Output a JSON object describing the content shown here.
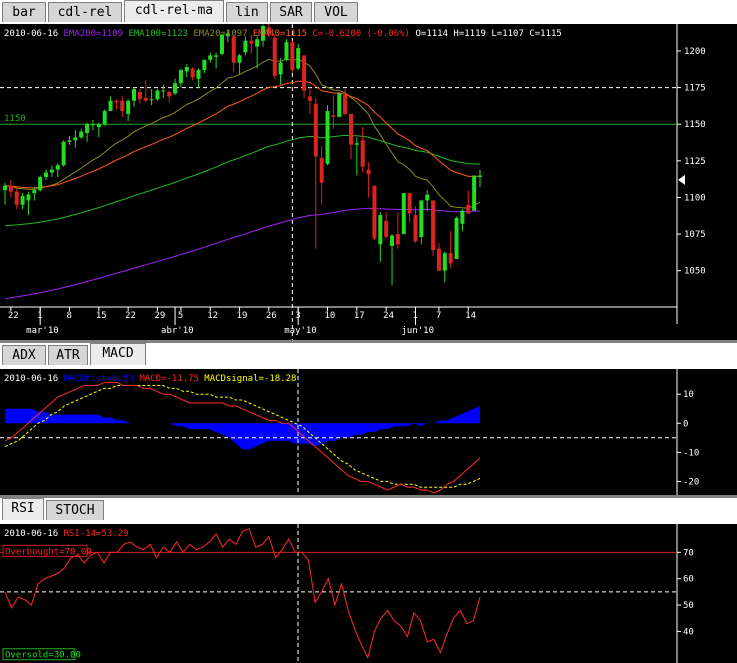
{
  "main_tabs": [
    {
      "label": "bar",
      "selected": false
    },
    {
      "label": "cdl-rel",
      "selected": false
    },
    {
      "label": "cdl-rel-ma",
      "selected": true
    },
    {
      "label": "lin",
      "selected": false
    },
    {
      "label": "SAR",
      "selected": false
    },
    {
      "label": "VOL",
      "selected": false
    }
  ],
  "macd_tabs": [
    {
      "label": "ADX",
      "selected": false
    },
    {
      "label": "ATR",
      "selected": false
    },
    {
      "label": "MACD",
      "selected": true
    }
  ],
  "rsi_tabs": [
    {
      "label": "RSI",
      "selected": true
    },
    {
      "label": "STOCH",
      "selected": false
    }
  ],
  "colors": {
    "up": "#22dd22",
    "down": "#dd2222",
    "ema200": "#a020f0",
    "ema100": "#22bb22",
    "ema20": "#8a8a20",
    "ema40": "#ff5a1a",
    "macd_hist": "#0000ff",
    "signal": "#ffff00",
    "rsi": "#ff2a2a"
  },
  "chart_data": [
    {
      "type": "candlestick",
      "legend": [
        {
          "text": "2010-06-16",
          "color": "#ffffff"
        },
        {
          "text": "EMA200=1109",
          "color": "#a020f0"
        },
        {
          "text": "EMA100=1123",
          "color": "#22bb22"
        },
        {
          "text": "EMA20=1097",
          "color": "#8a8a20"
        },
        {
          "text": "EMA40=1115",
          "color": "#ff5a1a"
        },
        {
          "text": "C=-0.6200 (-0.06%)",
          "color": "#ff2222"
        },
        {
          "text": "O=1114 H=1119 L=1107 C=1115",
          "color": "#ffffff"
        }
      ],
      "ylim": [
        1030,
        1215
      ],
      "y_ticks": [
        1050,
        1075,
        1100,
        1125,
        1150,
        1175,
        1200
      ],
      "hline_label": "1150",
      "hline_value": 1150,
      "crosshair_y": 1175,
      "crosshair_date": "2010-04-30",
      "last_price_marker": 1112,
      "x_ticks": [
        {
          "label": "22",
          "date": "2010-02-22"
        },
        {
          "label": "1",
          "date": "2010-03-01"
        },
        {
          "label": "8",
          "date": "2010-03-08"
        },
        {
          "label": "15",
          "date": "2010-03-15"
        },
        {
          "label": "22",
          "date": "2010-03-22"
        },
        {
          "label": "29",
          "date": "2010-03-29"
        },
        {
          "label": "5",
          "date": "2010-04-05"
        },
        {
          "label": "12",
          "date": "2010-04-12"
        },
        {
          "label": "19",
          "date": "2010-04-19"
        },
        {
          "label": "26",
          "date": "2010-04-26"
        },
        {
          "label": "3",
          "date": "2010-05-03"
        },
        {
          "label": "10",
          "date": "2010-05-10"
        },
        {
          "label": "17",
          "date": "2010-05-17"
        },
        {
          "label": "24",
          "date": "2010-05-24"
        },
        {
          "label": "1",
          "date": "2010-06-01"
        },
        {
          "label": "7",
          "date": "2010-06-07"
        },
        {
          "label": "14",
          "date": "2010-06-14"
        }
      ],
      "month_labels": [
        {
          "label": "mar'10",
          "date": "2010-03-01"
        },
        {
          "label": "abr'10",
          "date": "2010-04-01"
        },
        {
          "label": "may'10",
          "date": "2010-05-03"
        },
        {
          "label": "jun'10",
          "date": "2010-06-01"
        }
      ],
      "candles": [
        {
          "date": "2010-02-19",
          "o": 1105,
          "h": 1110,
          "l": 1095,
          "c": 1108
        },
        {
          "date": "2010-02-22",
          "o": 1108,
          "h": 1112,
          "l": 1100,
          "c": 1104
        },
        {
          "date": "2010-02-23",
          "o": 1104,
          "h": 1106,
          "l": 1092,
          "c": 1095
        },
        {
          "date": "2010-02-24",
          "o": 1095,
          "h": 1103,
          "l": 1092,
          "c": 1101
        },
        {
          "date": "2010-02-25",
          "o": 1098,
          "h": 1104,
          "l": 1088,
          "c": 1102
        },
        {
          "date": "2010-02-26",
          "o": 1103,
          "h": 1107,
          "l": 1098,
          "c": 1105
        },
        {
          "date": "2010-03-01",
          "o": 1105,
          "h": 1115,
          "l": 1104,
          "c": 1114
        },
        {
          "date": "2010-03-02",
          "o": 1114,
          "h": 1119,
          "l": 1112,
          "c": 1117
        },
        {
          "date": "2010-03-03",
          "o": 1117,
          "h": 1122,
          "l": 1114,
          "c": 1119
        },
        {
          "date": "2010-03-04",
          "o": 1119,
          "h": 1123,
          "l": 1114,
          "c": 1122
        },
        {
          "date": "2010-03-05",
          "o": 1122,
          "h": 1139,
          "l": 1121,
          "c": 1138
        },
        {
          "date": "2010-03-08",
          "o": 1138,
          "h": 1142,
          "l": 1136,
          "c": 1139
        },
        {
          "date": "2010-03-09",
          "o": 1139,
          "h": 1146,
          "l": 1134,
          "c": 1141
        },
        {
          "date": "2010-03-10",
          "o": 1141,
          "h": 1147,
          "l": 1140,
          "c": 1145
        },
        {
          "date": "2010-03-11",
          "o": 1144,
          "h": 1151,
          "l": 1138,
          "c": 1150
        },
        {
          "date": "2010-03-12",
          "o": 1150,
          "h": 1153,
          "l": 1146,
          "c": 1150
        },
        {
          "date": "2010-03-15",
          "o": 1148,
          "h": 1151,
          "l": 1141,
          "c": 1150
        },
        {
          "date": "2010-03-16",
          "o": 1150,
          "h": 1160,
          "l": 1149,
          "c": 1159
        },
        {
          "date": "2010-03-17",
          "o": 1159,
          "h": 1169,
          "l": 1159,
          "c": 1166
        },
        {
          "date": "2010-03-18",
          "o": 1166,
          "h": 1167,
          "l": 1160,
          "c": 1165
        },
        {
          "date": "2010-03-19",
          "o": 1166,
          "h": 1169,
          "l": 1155,
          "c": 1159
        },
        {
          "date": "2010-03-22",
          "o": 1157,
          "h": 1167,
          "l": 1152,
          "c": 1166
        },
        {
          "date": "2010-03-23",
          "o": 1166,
          "h": 1175,
          "l": 1162,
          "c": 1174
        },
        {
          "date": "2010-03-24",
          "o": 1172,
          "h": 1174,
          "l": 1164,
          "c": 1167
        },
        {
          "date": "2010-03-25",
          "o": 1168,
          "h": 1180,
          "l": 1165,
          "c": 1166
        },
        {
          "date": "2010-03-26",
          "o": 1167,
          "h": 1174,
          "l": 1163,
          "c": 1167
        },
        {
          "date": "2010-03-29",
          "o": 1167,
          "h": 1174,
          "l": 1166,
          "c": 1173
        },
        {
          "date": "2010-03-30",
          "o": 1173,
          "h": 1177,
          "l": 1168,
          "c": 1173
        },
        {
          "date": "2010-03-31",
          "o": 1172,
          "h": 1173,
          "l": 1165,
          "c": 1169
        },
        {
          "date": "2010-04-01",
          "o": 1171,
          "h": 1181,
          "l": 1170,
          "c": 1178
        },
        {
          "date": "2010-04-05",
          "o": 1178,
          "h": 1188,
          "l": 1175,
          "c": 1187
        },
        {
          "date": "2010-04-06",
          "o": 1186,
          "h": 1191,
          "l": 1182,
          "c": 1189
        },
        {
          "date": "2010-04-07",
          "o": 1188,
          "h": 1189,
          "l": 1180,
          "c": 1182
        },
        {
          "date": "2010-04-08",
          "o": 1181,
          "h": 1188,
          "l": 1175,
          "c": 1187
        },
        {
          "date": "2010-04-09",
          "o": 1187,
          "h": 1194,
          "l": 1185,
          "c": 1194
        },
        {
          "date": "2010-04-12",
          "o": 1194,
          "h": 1199,
          "l": 1192,
          "c": 1197
        },
        {
          "date": "2010-04-13",
          "o": 1196,
          "h": 1199,
          "l": 1188,
          "c": 1197
        },
        {
          "date": "2010-04-14",
          "o": 1198,
          "h": 1211,
          "l": 1197,
          "c": 1211
        },
        {
          "date": "2010-04-15",
          "o": 1210,
          "h": 1214,
          "l": 1206,
          "c": 1212
        },
        {
          "date": "2010-04-16",
          "o": 1210,
          "h": 1211,
          "l": 1186,
          "c": 1192
        },
        {
          "date": "2010-04-19",
          "o": 1192,
          "h": 1198,
          "l": 1184,
          "c": 1197
        },
        {
          "date": "2010-04-20",
          "o": 1199,
          "h": 1210,
          "l": 1197,
          "c": 1207
        },
        {
          "date": "2010-04-21",
          "o": 1207,
          "h": 1211,
          "l": 1198,
          "c": 1205
        },
        {
          "date": "2010-04-22",
          "o": 1203,
          "h": 1210,
          "l": 1188,
          "c": 1208
        },
        {
          "date": "2010-04-23",
          "o": 1207,
          "h": 1218,
          "l": 1203,
          "c": 1217
        },
        {
          "date": "2010-04-26",
          "o": 1216,
          "h": 1219,
          "l": 1210,
          "c": 1212
        },
        {
          "date": "2010-04-27",
          "o": 1209,
          "h": 1211,
          "l": 1181,
          "c": 1183
        },
        {
          "date": "2010-04-28",
          "o": 1184,
          "h": 1195,
          "l": 1177,
          "c": 1192
        },
        {
          "date": "2010-04-29",
          "o": 1194,
          "h": 1208,
          "l": 1193,
          "c": 1206
        },
        {
          "date": "2010-04-30",
          "o": 1206,
          "h": 1207,
          "l": 1185,
          "c": 1187
        },
        {
          "date": "2010-05-03",
          "o": 1188,
          "h": 1205,
          "l": 1187,
          "c": 1202
        },
        {
          "date": "2010-05-04",
          "o": 1197,
          "h": 1197,
          "l": 1168,
          "c": 1173
        },
        {
          "date": "2010-05-05",
          "o": 1169,
          "h": 1175,
          "l": 1157,
          "c": 1166
        },
        {
          "date": "2010-05-06",
          "o": 1164,
          "h": 1168,
          "l": 1065,
          "c": 1128
        },
        {
          "date": "2010-05-07",
          "o": 1127,
          "h": 1135,
          "l": 1095,
          "c": 1110
        },
        {
          "date": "2010-05-10",
          "o": 1123,
          "h": 1163,
          "l": 1122,
          "c": 1159
        },
        {
          "date": "2010-05-11",
          "o": 1156,
          "h": 1170,
          "l": 1147,
          "c": 1155
        },
        {
          "date": "2010-05-12",
          "o": 1155,
          "h": 1172,
          "l": 1155,
          "c": 1171
        },
        {
          "date": "2010-05-13",
          "o": 1170,
          "h": 1174,
          "l": 1156,
          "c": 1157
        },
        {
          "date": "2010-05-14",
          "o": 1157,
          "h": 1157,
          "l": 1126,
          "c": 1136
        },
        {
          "date": "2010-05-17",
          "o": 1136,
          "h": 1141,
          "l": 1115,
          "c": 1137
        },
        {
          "date": "2010-05-18",
          "o": 1139,
          "h": 1148,
          "l": 1117,
          "c": 1121
        },
        {
          "date": "2010-05-19",
          "o": 1119,
          "h": 1124,
          "l": 1100,
          "c": 1116
        },
        {
          "date": "2010-05-20",
          "o": 1108,
          "h": 1108,
          "l": 1071,
          "c": 1072
        },
        {
          "date": "2010-05-21",
          "o": 1068,
          "h": 1090,
          "l": 1056,
          "c": 1088
        },
        {
          "date": "2010-05-24",
          "o": 1084,
          "h": 1090,
          "l": 1072,
          "c": 1073
        },
        {
          "date": "2010-05-25",
          "o": 1067,
          "h": 1075,
          "l": 1040,
          "c": 1074
        },
        {
          "date": "2010-05-26",
          "o": 1075,
          "h": 1090,
          "l": 1065,
          "c": 1068
        },
        {
          "date": "2010-05-27",
          "o": 1075,
          "h": 1103,
          "l": 1075,
          "c": 1103
        },
        {
          "date": "2010-05-28",
          "o": 1103,
          "h": 1103,
          "l": 1083,
          "c": 1089
        },
        {
          "date": "2010-06-01",
          "o": 1088,
          "h": 1094,
          "l": 1069,
          "c": 1070
        },
        {
          "date": "2010-06-02",
          "o": 1073,
          "h": 1098,
          "l": 1068,
          "c": 1098
        },
        {
          "date": "2010-06-03",
          "o": 1098,
          "h": 1105,
          "l": 1091,
          "c": 1102
        },
        {
          "date": "2010-06-04",
          "o": 1098,
          "h": 1098,
          "l": 1060,
          "c": 1064
        },
        {
          "date": "2010-06-07",
          "o": 1065,
          "h": 1069,
          "l": 1050,
          "c": 1050
        },
        {
          "date": "2010-06-08",
          "o": 1050,
          "h": 1063,
          "l": 1042,
          "c": 1062
        },
        {
          "date": "2010-06-09",
          "o": 1062,
          "h": 1077,
          "l": 1052,
          "c": 1055
        },
        {
          "date": "2010-06-10",
          "o": 1058,
          "h": 1087,
          "l": 1058,
          "c": 1086
        },
        {
          "date": "2010-06-11",
          "o": 1082,
          "h": 1092,
          "l": 1077,
          "c": 1091
        },
        {
          "date": "2010-06-14",
          "o": 1095,
          "h": 1105,
          "l": 1089,
          "c": 1089
        },
        {
          "date": "2010-06-15",
          "o": 1091,
          "h": 1115,
          "l": 1091,
          "c": 1115
        },
        {
          "date": "2010-06-16",
          "o": 1114,
          "h": 1119,
          "l": 1107,
          "c": 1115
        }
      ]
    },
    {
      "type": "macd",
      "legend": [
        {
          "text": "2010-06-16",
          "color": "#ffffff"
        },
        {
          "text": "MACDhist=6.53",
          "color": "#0000ff"
        },
        {
          "text": "MACD=-11.75",
          "color": "#ff2222"
        },
        {
          "text": "MACDsignal=-18.28",
          "color": "#ffff00"
        }
      ],
      "ylim": [
        -24,
        18
      ],
      "y_ticks": [
        -20,
        -10,
        0,
        10
      ],
      "crosshair_y": -5,
      "macd": [
        -6,
        -5,
        -3,
        -1,
        1,
        3,
        5,
        7,
        9,
        10,
        11,
        12,
        13,
        13,
        13,
        14,
        14,
        14,
        13,
        13,
        13,
        12,
        12,
        11,
        10,
        10,
        9,
        8,
        7,
        7,
        7,
        7,
        7,
        7,
        6,
        6,
        5,
        4,
        3,
        2,
        1,
        1,
        0,
        0,
        -2,
        -4,
        -6,
        -8,
        -10,
        -12,
        -14,
        -16,
        -18,
        -19,
        -20,
        -20,
        -21,
        -22,
        -23,
        -22,
        -21,
        -22,
        -22,
        -23,
        -23,
        -24,
        -23,
        -21,
        -20,
        -18,
        -16,
        -14,
        -12
      ],
      "signal": [
        -8,
        -7,
        -6,
        -4,
        -2,
        0,
        1,
        3,
        4,
        6,
        7,
        8,
        9,
        10,
        11,
        12,
        12,
        13,
        13,
        13,
        13,
        13,
        13,
        13,
        13,
        12,
        12,
        11,
        11,
        10,
        10,
        10,
        9,
        9,
        9,
        8,
        8,
        7,
        6,
        5,
        4,
        3,
        2,
        1,
        0,
        -1,
        -3,
        -5,
        -7,
        -9,
        -11,
        -13,
        -14,
        -16,
        -17,
        -18,
        -19,
        -20,
        -20,
        -21,
        -21,
        -21,
        -21,
        -22,
        -22,
        -22,
        -22,
        -22,
        -22,
        -21,
        -21,
        -20,
        -19
      ],
      "hist": [
        5,
        5,
        5,
        5,
        5,
        4,
        4,
        3,
        3,
        3,
        3,
        3,
        3,
        3,
        3,
        2,
        2,
        1,
        1,
        0,
        0,
        0,
        0,
        0,
        0,
        0,
        -1,
        -1,
        -2,
        -2,
        -2,
        -2,
        -3,
        -4,
        -5,
        -7,
        -9,
        -9,
        -8,
        -7,
        -6,
        -6,
        -6,
        -6,
        -7,
        -7,
        -7,
        -8,
        -7,
        -6,
        -6,
        -5,
        -5,
        -4,
        -4,
        -3,
        -3,
        -2,
        -2,
        -1,
        -1,
        -1,
        0,
        -1,
        0,
        0,
        1,
        1,
        2,
        3,
        4,
        5,
        6
      ]
    },
    {
      "type": "rsi",
      "legend": [
        {
          "text": "2010-06-16",
          "color": "#ffffff"
        },
        {
          "text": "RSI-14=53.29",
          "color": "#ff2222"
        }
      ],
      "overbought_label": "Overbought=70.00",
      "oversold_label": "Oversold=30.00",
      "overbought": 70,
      "oversold": 30,
      "ylim": [
        28,
        80
      ],
      "y_ticks": [
        40,
        50,
        60,
        70
      ],
      "crosshair_y": 55,
      "rsi": [
        55,
        49,
        53,
        52,
        50,
        58,
        60,
        61,
        62,
        64,
        68,
        69,
        66,
        69,
        70,
        66,
        70,
        70,
        73,
        74,
        72,
        71,
        73,
        68,
        72,
        70,
        74,
        70,
        73,
        71,
        72,
        74,
        77,
        72,
        75,
        73,
        78,
        79,
        72,
        73,
        76,
        68,
        71,
        75,
        70,
        70,
        67,
        51,
        55,
        60,
        50,
        58,
        48,
        41,
        35,
        30,
        40,
        45,
        48,
        44,
        42,
        38,
        47,
        44,
        36,
        37,
        32,
        39,
        45,
        48,
        43,
        44,
        53
      ]
    }
  ]
}
